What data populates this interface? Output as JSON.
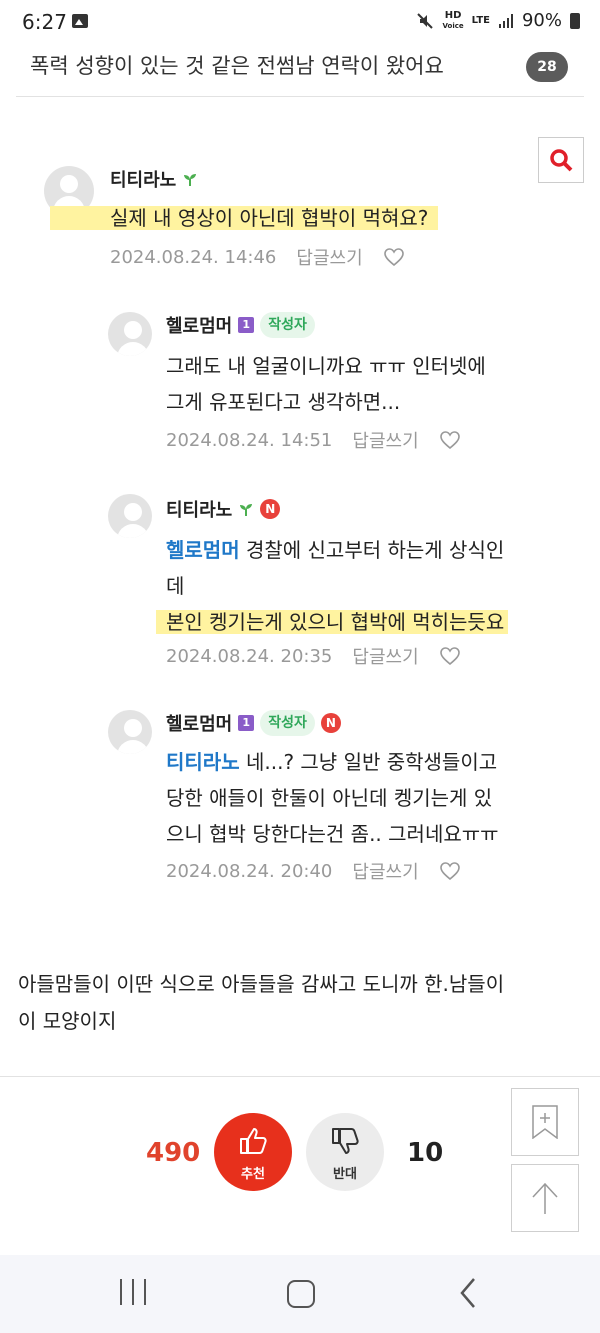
{
  "status_bar": {
    "time": "6:27",
    "net_hd": "HD",
    "net_voice": "Voice",
    "net_lte": "LTE",
    "battery": "90%"
  },
  "header": {
    "title": "폭력 성향이 있는 것 같은 전썸남 연락이 왔어요",
    "comment_count": "28"
  },
  "comments": [
    {
      "nickname": "티티라노",
      "text": "실제 내 영상이 아닌데 협박이 먹혀요?",
      "date": "2024.08.24. 14:46",
      "reply_label": "답글쓰기"
    },
    {
      "nickname": "헬로멈머",
      "level": "1",
      "author_badge": "작성자",
      "line1": "그래도 내 얼굴이니까요 ㅠㅠ 인터넷에",
      "line2": "그게 유포된다고 생각하면...",
      "date": "2024.08.24. 14:51",
      "reply_label": "답글쓰기"
    },
    {
      "nickname": "티티라노",
      "new_badge": "N",
      "mention": "헬로멈머",
      "line1_rest": " 경찰에 신고부터 하는게 상식인",
      "line2": "데",
      "line3": "본인 켕기는게 있으니 협박에 먹히는듯요",
      "date": "2024.08.24. 20:35",
      "reply_label": "답글쓰기"
    },
    {
      "nickname": "헬로멈머",
      "level": "1",
      "author_badge": "작성자",
      "new_badge": "N",
      "mention": "티티라노",
      "line1_rest": " 네...? 그냥 일반 중학생들이고",
      "line2": "당한 애들이 한둘이 아닌데 켕기는게 있",
      "line3": "으니 협박 당한다는건 좀.. 그러네요ㅠㅠ",
      "date": "2024.08.24. 20:40",
      "reply_label": "답글쓰기"
    }
  ],
  "post_text": {
    "line1": "아들맘들이 이딴 식으로 아들들을 감싸고 도니까 한.남들이",
    "line2": "이 모양이지"
  },
  "votes": {
    "up_count": "490",
    "up_label": "추천",
    "down_label": "반대",
    "down_count": "10"
  },
  "colors": {
    "highlight": "#fff3a0",
    "mention": "#1f78c8",
    "upvote": "#e7301c"
  },
  "icons": [
    "search-icon",
    "sprout-icon",
    "heart-icon",
    "thumbs-up-icon",
    "thumbs-down-icon",
    "bookmark-add-icon",
    "scroll-top-icon"
  ]
}
